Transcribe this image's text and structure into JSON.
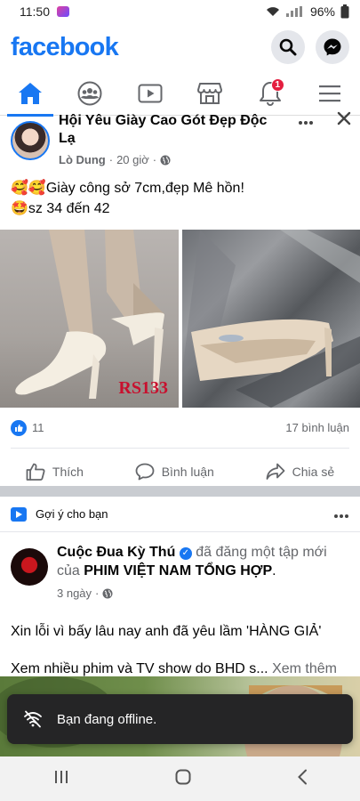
{
  "status_bar": {
    "time": "11:50",
    "battery": "96%"
  },
  "header": {
    "logo": "facebook"
  },
  "tabs": {
    "notification_count": "1"
  },
  "post1": {
    "group_name": "Hội Yêu Giày Cao Gót Đẹp Độc Lạ",
    "author": "Lò Dung",
    "time": "20 giờ",
    "dot": "·",
    "line1": "🥰🥰Giày công sở 7cm,đẹp Mê hồn!",
    "line2": "🤩sz 34 đến 42",
    "image_label": "RS133",
    "like_count": "11",
    "comment_count": "17 bình luận",
    "actions": {
      "like": "Thích",
      "comment": "Bình luận",
      "share": "Chia sẻ"
    }
  },
  "suggest": {
    "label": "Gợi ý cho bạn"
  },
  "post2": {
    "page_name": "Cuộc Đua Kỳ Thú",
    "action_text": "đã đăng một tập mới của",
    "target": "PHIM VIỆT NAM TỔNG HỢP",
    "period": ".",
    "time": "3 ngày",
    "dot": "·",
    "body1": "Xin lỗi vì bấy lâu nay anh đã yêu lầm 'HÀNG GIẢ'",
    "body2": "Xem nhiều phim và TV show do BHD s...",
    "see_more": "Xem thêm"
  },
  "toast": {
    "text": "Bạn đang offline."
  },
  "colors": {
    "brand": "#1877f2",
    "badge": "#e41e3f",
    "toast_bg": "#252526"
  }
}
